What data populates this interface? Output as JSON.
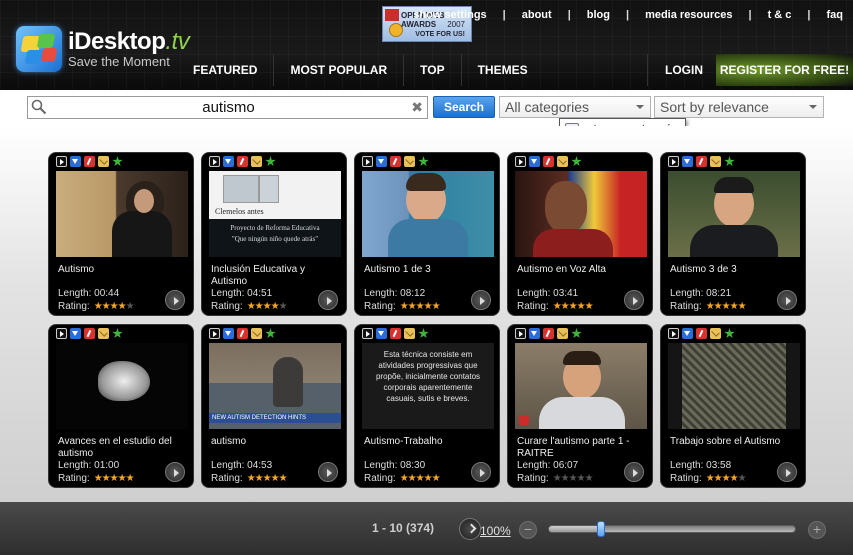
{
  "header": {
    "logo_name": "iDesktop",
    "logo_suffix": ".tv",
    "tagline": "Save the Moment",
    "top_links": [
      "about",
      "blog",
      "media resources",
      "t & c",
      "faq"
    ],
    "top_link_first": "show settings",
    "badge": {
      "line1": "OPEN WEB AWARDS",
      "line2": "2007",
      "line3": "VOTE FOR US!"
    },
    "nav": [
      "FEATURED",
      "MOST POPULAR",
      "TOP",
      "THEMES"
    ],
    "login": "LOGIN",
    "register": "REGISTER FOR FREE!"
  },
  "search": {
    "value": "autismo",
    "clear_glyph": "✖",
    "button": "Search",
    "category": "All categories",
    "sort": "Sort by relevance",
    "tooltip": "category: categoría"
  },
  "videos": [
    {
      "title": "Autismo",
      "length": "Length: 00:44",
      "rating_label": "Rating:",
      "rating": 4
    },
    {
      "title": "Inclusión Educativa y Autismo",
      "length": "Length: 04:51",
      "rating_label": "Rating:",
      "rating": 4,
      "thumb_text_1": "Clemelos antes",
      "thumb_text_2": "Proyecto de Reforma Educativa",
      "thumb_text_3": "\"Que ningún niño quede atrás\""
    },
    {
      "title": "Autismo 1 de 3",
      "length": "Length: 08:12",
      "rating_label": "Rating:",
      "rating": 5
    },
    {
      "title": "Autismo en Voz Alta",
      "length": "Length: 03:41",
      "rating_label": "Rating:",
      "rating": 5
    },
    {
      "title": "Autismo 3 de 3",
      "length": "Length: 08:21",
      "rating_label": "Rating:",
      "rating": 5
    },
    {
      "title": "Avances en el estudio del autismo",
      "length": "Length: 01:00",
      "rating_label": "Rating:",
      "rating": 5
    },
    {
      "title": "autismo",
      "length": "Length: 04:53",
      "rating_label": "Rating:",
      "rating": 5,
      "thumb_text_1": "NEW AUTISM DETECTION HINTS"
    },
    {
      "title": "Autismo-Trabalho",
      "length": "Length: 08:30",
      "rating_label": "Rating:",
      "rating": 5,
      "thumb_text_1": "Esta técnica consiste em atividades progressivas que propõe, inicialmente contatos corporais aparentemente casuais, sutis e breves."
    },
    {
      "title": "Curare l'autismo parte 1 - RAITRE",
      "length": "Length: 06:07",
      "rating_label": "Rating:",
      "rating": 0
    },
    {
      "title": "Trabajo sobre el Autismo",
      "length": "Length: 03:58",
      "rating_label": "Rating:",
      "rating": 4
    }
  ],
  "footer": {
    "pagination": "1 - 10 (374)",
    "zoom": "100%",
    "zoom_level": 0.21
  }
}
